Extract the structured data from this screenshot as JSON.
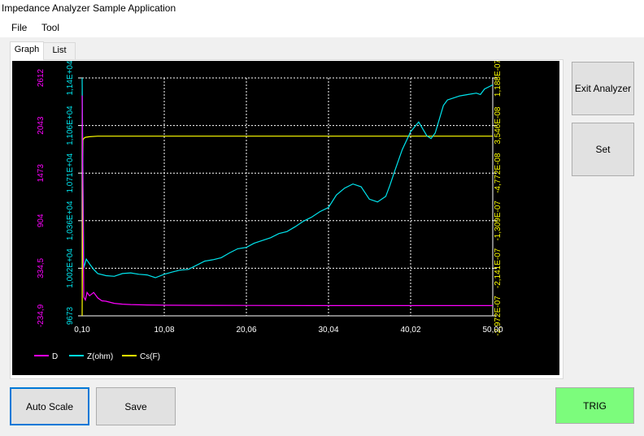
{
  "window": {
    "title": "Impedance Analyzer Sample Application"
  },
  "menu": {
    "file": "File",
    "tool": "Tool"
  },
  "tabs": {
    "graph": "Graph",
    "list": "List"
  },
  "buttons": {
    "exit_analyzer": "Exit Analyzer",
    "set": "Set",
    "auto_scale": "Auto Scale",
    "save": "Save",
    "trig": "TRIG"
  },
  "colors": {
    "chart_bg": "#000000",
    "d": "#ff00ff",
    "z": "#00e5ee",
    "cs": "#ffff00",
    "x_ticks": "#ffffff",
    "trig_bg": "#7cfc7c",
    "focus_border": "#0078d7"
  },
  "chart_data": {
    "type": "line",
    "x_ticks": [
      "0,10",
      "10,08",
      "20,06",
      "30,04",
      "40,02",
      "50,00"
    ],
    "xlim": [
      0.1,
      50.0
    ],
    "axes": {
      "d": {
        "ticks": [
          "2612",
          "2043",
          "1473",
          "904",
          "334,5",
          "-234,9"
        ],
        "ylim": [
          -234.9,
          2612
        ]
      },
      "z": {
        "ticks": [
          "1,14E+04",
          "1,106E+04",
          "1,071E+04",
          "1,036E+04",
          "1,002E+04",
          "9673"
        ],
        "ylim": [
          9673,
          11400
        ]
      },
      "cs": {
        "ticks": [
          "1,188E-07",
          "3,546E-08",
          "-4,772E-08",
          "-1,309E-07",
          "-2,141E-07",
          "-2,972E-07"
        ],
        "ylim": [
          -2.972e-07,
          1.188e-07
        ]
      }
    },
    "legend": [
      {
        "key": "d",
        "label": "D"
      },
      {
        "key": "z",
        "label": "Z(ohm)"
      },
      {
        "key": "cs",
        "label": "Cs(F)"
      }
    ],
    "series": [
      {
        "name": "D",
        "axis": "d",
        "x": [
          0.1,
          0.3,
          0.5,
          0.7,
          1.0,
          1.5,
          2.0,
          2.5,
          3.0,
          4.0,
          5.0,
          6.0,
          8.0,
          10.08,
          15.0,
          20.06,
          30.04,
          40.02,
          50.0
        ],
        "y": [
          2400,
          -10,
          -45,
          45,
          5,
          45,
          -20,
          -55,
          -60,
          -85,
          -95,
          -100,
          -105,
          -108,
          -110,
          -111,
          -112,
          -112,
          -112
        ]
      },
      {
        "name": "Z(ohm)",
        "axis": "z",
        "x": [
          0.1,
          0.3,
          0.6,
          1.0,
          1.5,
          2.0,
          3.0,
          4.0,
          5.0,
          6.0,
          7.0,
          8.0,
          9.0,
          10.08,
          11.0,
          12.0,
          13.0,
          14.0,
          15.0,
          16.0,
          17.0,
          18.0,
          19.0,
          20.06,
          21.0,
          22.0,
          23.0,
          24.0,
          25.0,
          26.0,
          27.0,
          28.0,
          29.0,
          30.04,
          31.0,
          32.0,
          33.0,
          34.0,
          35.0,
          36.0,
          37.0,
          37.5,
          38.0,
          39.0,
          40.02,
          41.0,
          42.0,
          42.5,
          43.0,
          44.0,
          44.5,
          45.0,
          46.0,
          47.0,
          48.0,
          48.5,
          49.0,
          50.0
        ],
        "y": [
          11400,
          10020,
          10085,
          10050,
          10010,
          9980,
          9965,
          9960,
          9980,
          9985,
          9975,
          9970,
          9950,
          9975,
          9990,
          10005,
          10010,
          10040,
          10070,
          10080,
          10095,
          10130,
          10160,
          10170,
          10200,
          10220,
          10240,
          10270,
          10285,
          10320,
          10360,
          10390,
          10430,
          10460,
          10550,
          10600,
          10630,
          10610,
          10520,
          10500,
          10540,
          10620,
          10710,
          10880,
          11010,
          11080,
          10980,
          10960,
          11000,
          11200,
          11240,
          11250,
          11270,
          11280,
          11290,
          11280,
          11320,
          11350
        ]
      },
      {
        "name": "Cs(F)",
        "axis": "cs",
        "x": [
          0.1,
          0.2,
          0.3,
          0.5,
          1.0,
          2.0,
          5.0,
          10.08,
          20.06,
          30.04,
          40.02,
          50.0
        ],
        "y": [
          -2.972e-07,
          1e-08,
          1.3e-08,
          1.5e-08,
          1.6e-08,
          1.7e-08,
          1.7e-08,
          1.7e-08,
          1.7e-08,
          1.7e-08,
          1.7e-08,
          1.7e-08
        ]
      }
    ]
  }
}
